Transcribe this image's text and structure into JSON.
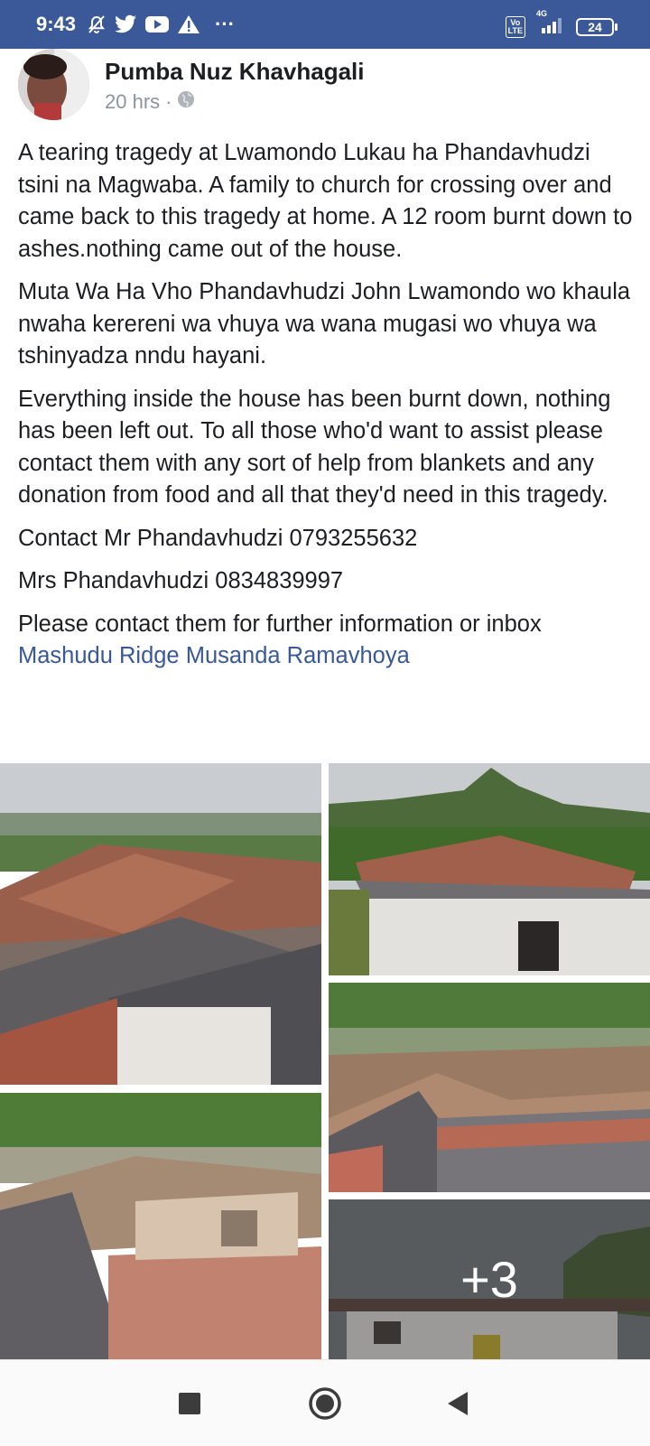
{
  "status_bar": {
    "time": "9:43",
    "network": "4G",
    "volte": "Vo LTE",
    "battery": "24",
    "more": "···"
  },
  "post": {
    "author": "Pumba Nuz Khavhagali",
    "time": "20 hrs",
    "separator": "·",
    "paragraphs": [
      "A tearing tragedy at Lwamondo Lukau ha Phandavhudzi tsini na Magwaba. A family to church for crossing over and came back to this tragedy at home. A 12 room burnt down to ashes.nothing came out of the house.",
      "Muta Wa Ha Vho Phandavhudzi John Lwamondo wo khaula nwaha kerereni wa vhuya wa wana mugasi wo vhuya wa tshinyadza nndu hayani.",
      "Everything inside the house has been burnt down, nothing has been left out. To all those who'd want to assist please contact them with any sort of help from blankets and any donation from food and all that they'd need in this tragedy.",
      "Contact Mr Phandavhudzi 0793255632",
      "Mrs Phandavhudzi 0834839997"
    ],
    "last_paragraph": "Please contact them for further information or inbox",
    "mention": "Mashudu Ridge Musanda Ramavhoya",
    "more_photos": "+3"
  },
  "colors": {
    "status_bar": "#3b5998",
    "link": "#385898",
    "text": "#1c1e21",
    "meta": "#8d949e"
  }
}
